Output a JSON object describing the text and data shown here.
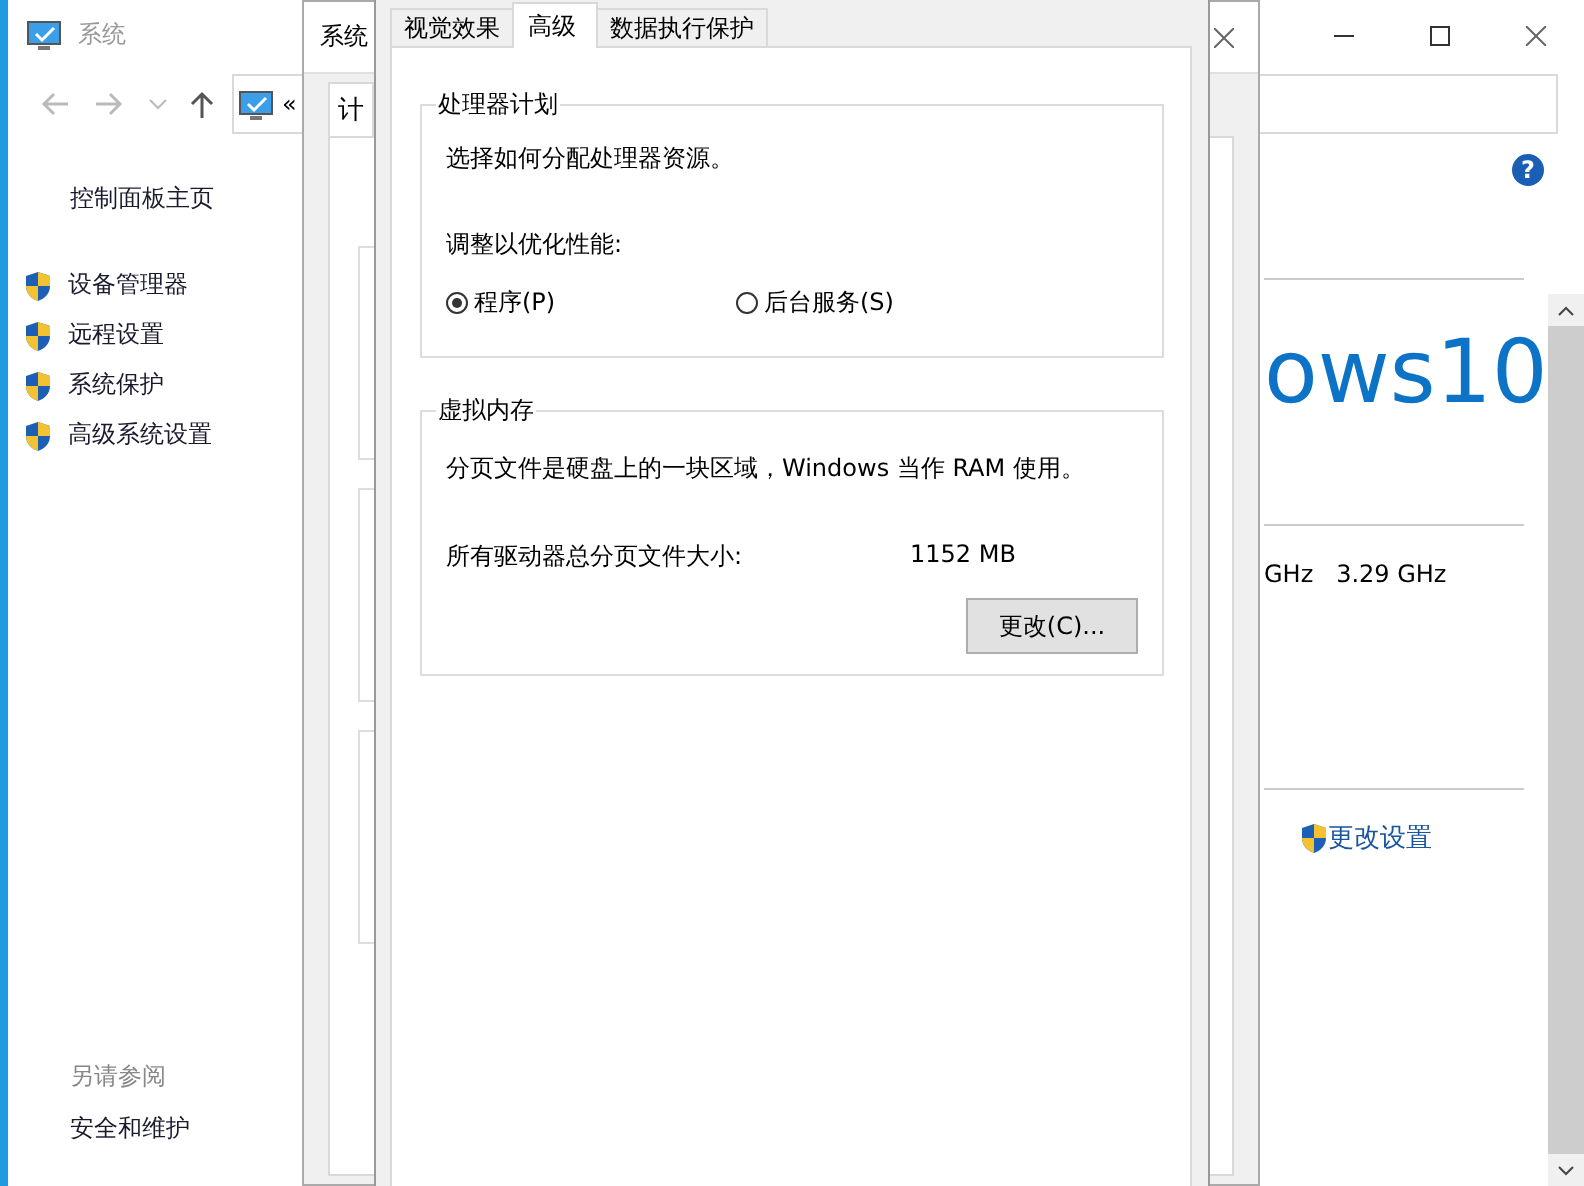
{
  "back_window": {
    "title": "系统",
    "address_chevron": "«",
    "sidebar_home": "控制面板主页",
    "sidebar_links": [
      "设备管理器",
      "远程设置",
      "系统保护",
      "高级系统设置"
    ],
    "see_also_heading": "另请参阅",
    "see_also_links": [
      "安全和维护"
    ],
    "help_button": "?",
    "logo_text": "ows10",
    "processor_speed": "GHz   3.29 GHz",
    "change_settings_link": "更改设置"
  },
  "middle_window": {
    "title": "系统",
    "tabs": [
      {
        "label": "计",
        "selected": true
      }
    ]
  },
  "dialog": {
    "tabs": [
      {
        "label": "视觉效果",
        "selected": false
      },
      {
        "label": "高级",
        "selected": true
      },
      {
        "label": "数据执行保护",
        "selected": false
      }
    ],
    "processor_group": {
      "title": "处理器计划",
      "description": "选择如何分配处理器资源。",
      "prompt": "调整以优化性能:",
      "options": [
        {
          "label": "程序(P)",
          "selected": true
        },
        {
          "label": "后台服务(S)",
          "selected": false
        }
      ]
    },
    "memory_group": {
      "title": "虚拟内存",
      "description": "分页文件是硬盘上的一块区域，Windows 当作 RAM 使用。",
      "total_label": "所有驱动器总分页文件大小:",
      "total_value": "1152 MB",
      "change_button": "更改(C)..."
    }
  }
}
